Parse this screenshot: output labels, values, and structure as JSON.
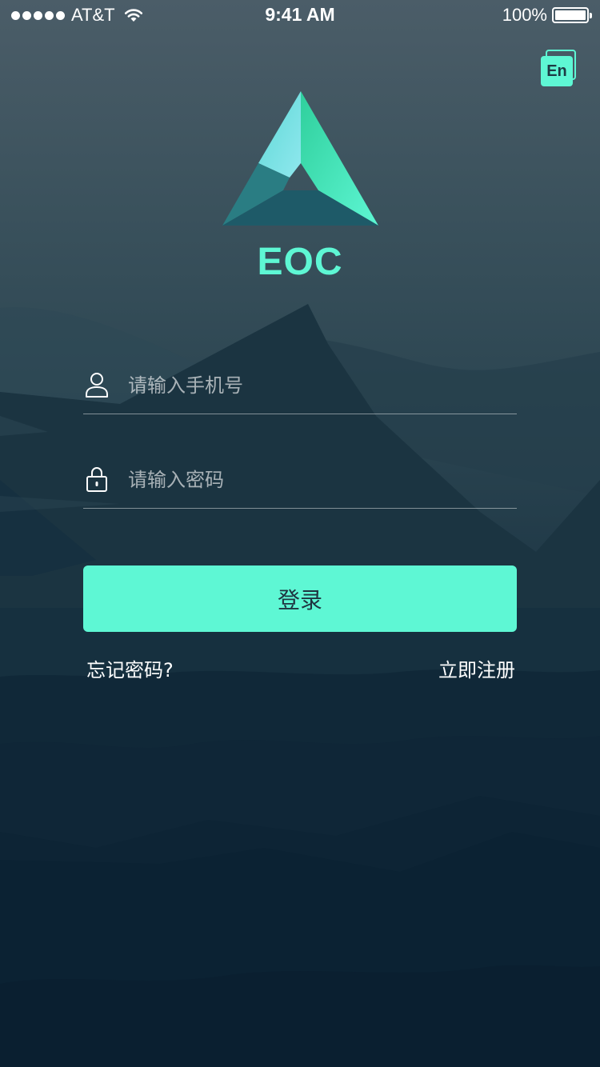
{
  "status_bar": {
    "carrier": "AT&T",
    "time": "9:41 AM",
    "battery_percent": "100%",
    "signal_bars": 5
  },
  "header": {
    "language_toggle_label": "En"
  },
  "brand": {
    "name": "EOC",
    "accent_color": "#5ef7d4"
  },
  "form": {
    "phone": {
      "placeholder": "请输入手机号",
      "value": "",
      "icon": "user-icon"
    },
    "password": {
      "placeholder": "请输入密码",
      "value": "",
      "icon": "lock-icon"
    },
    "login_label": "登录"
  },
  "links": {
    "forgot_password": "忘记密码?",
    "register": "立即注册"
  }
}
